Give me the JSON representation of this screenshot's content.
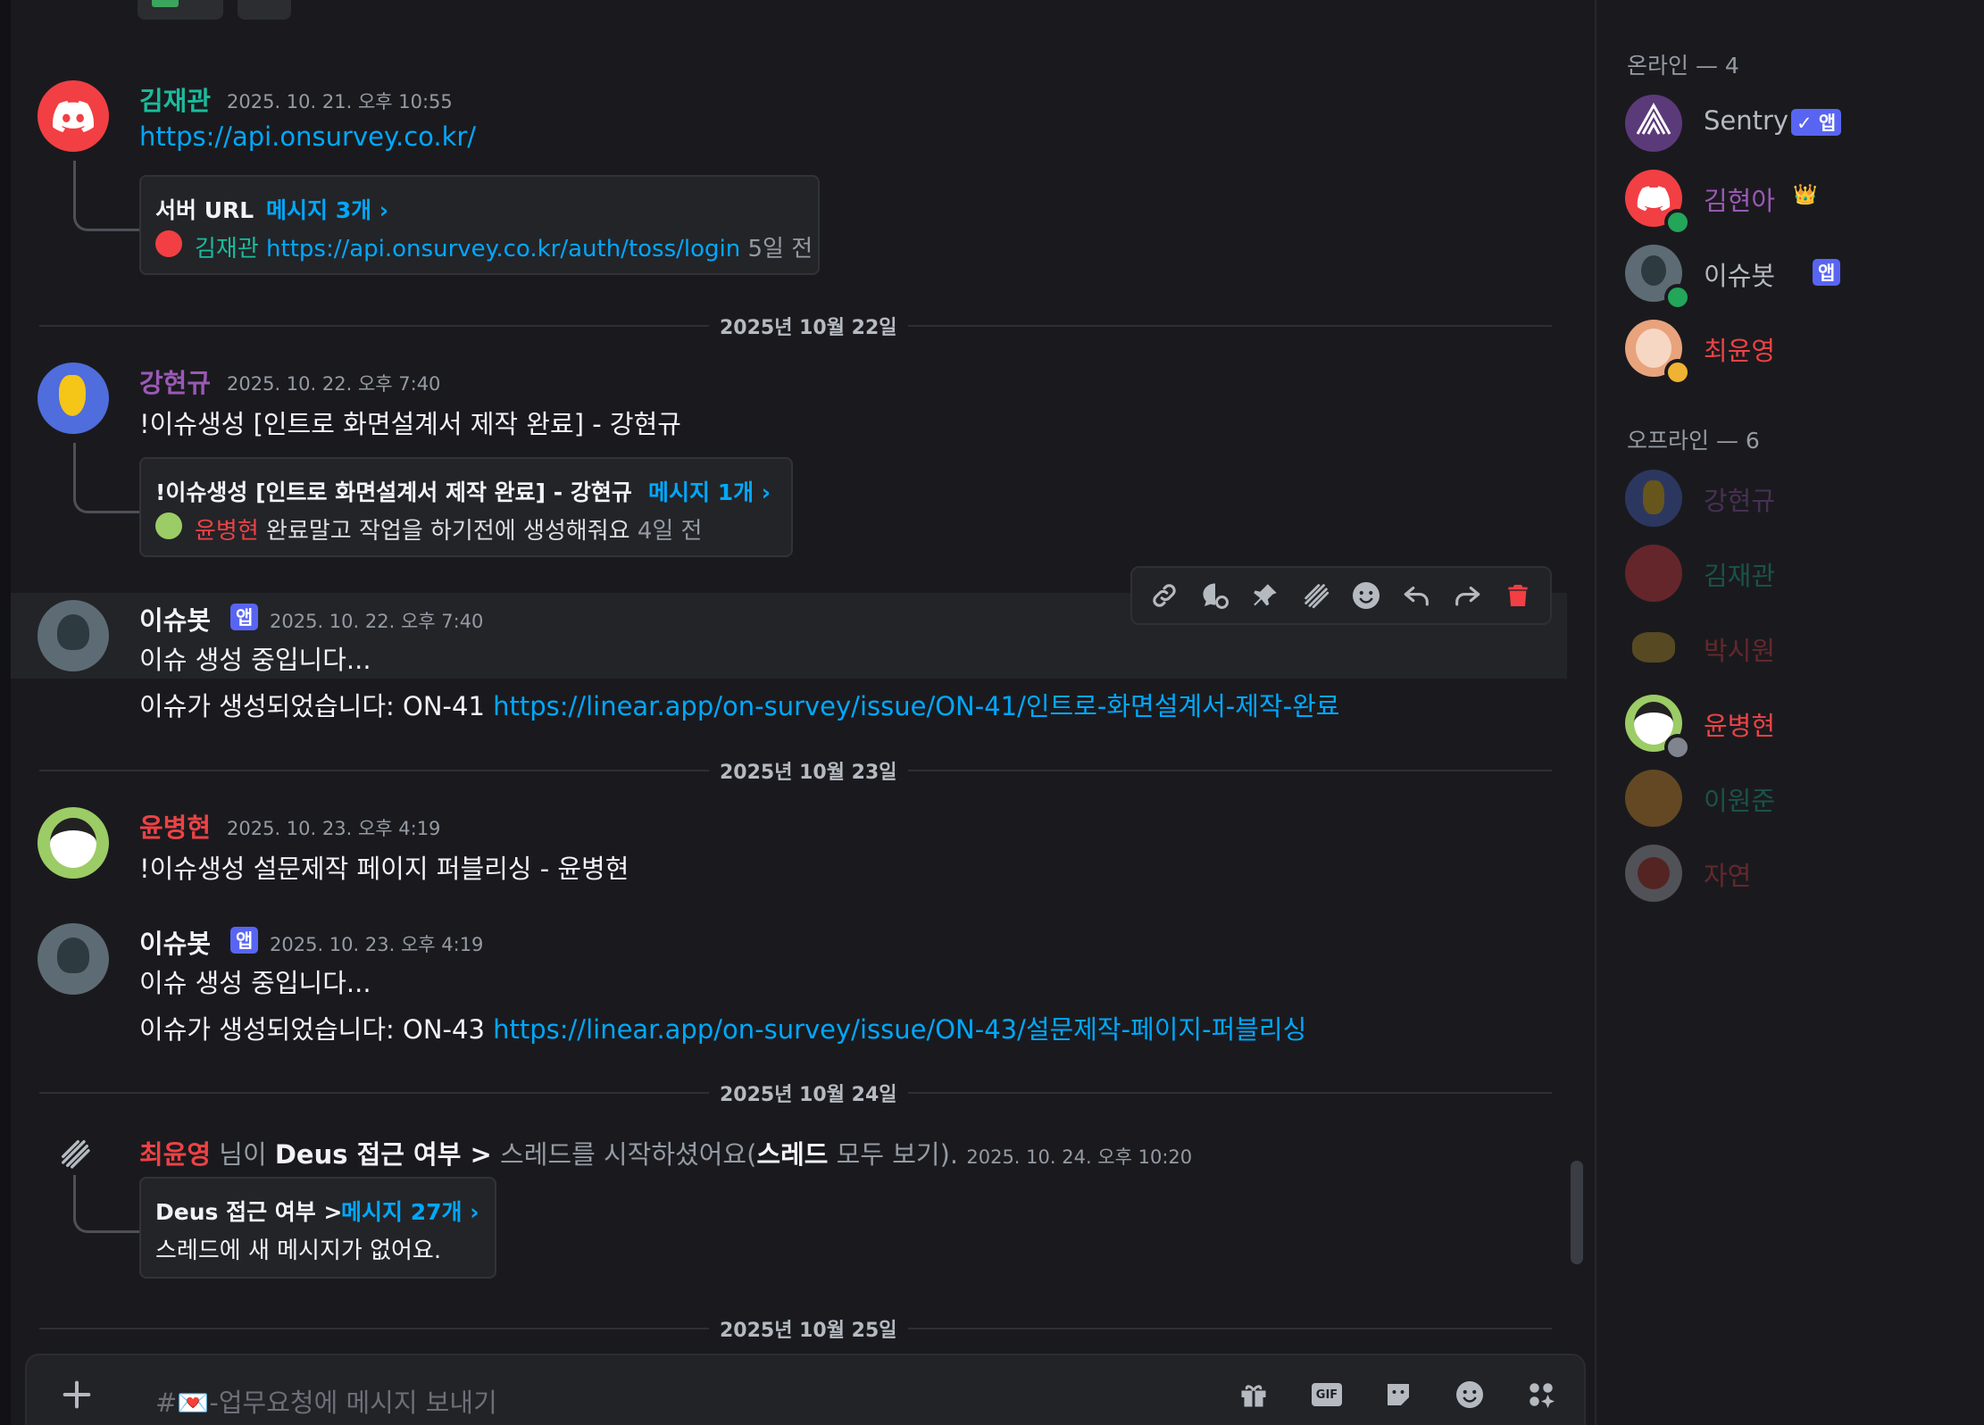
{
  "messages": {
    "m1": {
      "author": "김재관",
      "author_color": "#1abc9c",
      "timestamp": "2025. 10. 21. 오후 10:55",
      "link": "https://api.onsurvey.co.kr/",
      "thread": {
        "title": "서버 URL",
        "count": "메시지 3개 ›",
        "last_author": "김재관",
        "last_text": "https://api.onsurvey.co.kr/auth/toss/login",
        "ago": "5일 전"
      }
    },
    "m2": {
      "author": "강현규",
      "author_color": "#9b59b6",
      "timestamp": "2025. 10. 22. 오후 7:40",
      "text": "!이슈생성 [인트로 화면설계서 제작 완료] - 강현규",
      "thread": {
        "title": "!이슈생성 [인트로 화면설계서 제작 완료] - 강현규",
        "count": "메시지 1개 ›",
        "last_author": "윤병현",
        "last_text": "완료말고 작업을 하기전에 생성해줘요",
        "ago": "4일 전"
      }
    },
    "m3": {
      "author": "이슈봇",
      "tag": "앱",
      "timestamp": "2025. 10. 22. 오후 7:40",
      "line1": "이슈 생성 중입니다...",
      "line2_prefix": "이슈가 생성되었습니다: ON-41",
      "line2_link": "https://linear.app/on-survey/issue/ON-41/인트로-화면설계서-제작-완료"
    },
    "m4": {
      "author": "윤병현",
      "author_color": "#ed4245",
      "timestamp": "2025. 10. 23. 오후 4:19",
      "text": "!이슈생성 설문제작 페이지 퍼블리싱 - 윤병현"
    },
    "m5": {
      "author": "이슈봇",
      "tag": "앱",
      "timestamp": "2025. 10. 23. 오후 4:19",
      "line1": "이슈 생성 중입니다...",
      "line2_prefix": "이슈가 생성되었습니다: ON-43",
      "line2_link": "https://linear.app/on-survey/issue/ON-43/설문제작-페이지-퍼블리싱"
    },
    "m6": {
      "author": "최윤영",
      "author_color": "#ed4245",
      "mid1": "님이",
      "thread_name": "Deus 접근 여부 >",
      "mid2": "스레드를 시작하셨어요(",
      "see_all_bold": "스레드",
      "see_all_rest": "모두 보기).",
      "timestamp": "2025. 10. 24. 오후 10:20",
      "thread": {
        "title": "Deus 접근 여부 >",
        "count": "메시지 27개 ›",
        "empty": "스레드에 새 메시지가 없어요."
      }
    }
  },
  "separators": [
    "2025년 10월 22일",
    "2025년 10월 23일",
    "2025년 10월 24일",
    "2025년 10월 25일"
  ],
  "composer": {
    "placeholder": "#💌-업무요청에 메시지 보내기"
  },
  "members": {
    "online_header": "온라인 — 4",
    "offline_header": "오프라인 — 6",
    "online": [
      {
        "name": "Sentry",
        "color": "#b5bac1",
        "tag": "✓ 앱"
      },
      {
        "name": "김현아",
        "color": "#9b59b6",
        "crown": "👑"
      },
      {
        "name": "이슈봇",
        "color": "#b5bac1",
        "tag": "앱"
      },
      {
        "name": "최윤영",
        "color": "#ed4245"
      }
    ],
    "offline": [
      {
        "name": "강현규",
        "color": "#9b59b6"
      },
      {
        "name": "김재관",
        "color": "#1abc9c"
      },
      {
        "name": "박시원",
        "color": "#ed4245"
      },
      {
        "name": "윤병현",
        "color": "#ed4245"
      },
      {
        "name": "이원준",
        "color": "#1abc9c"
      },
      {
        "name": "자연",
        "color": "#ed4245"
      }
    ]
  }
}
